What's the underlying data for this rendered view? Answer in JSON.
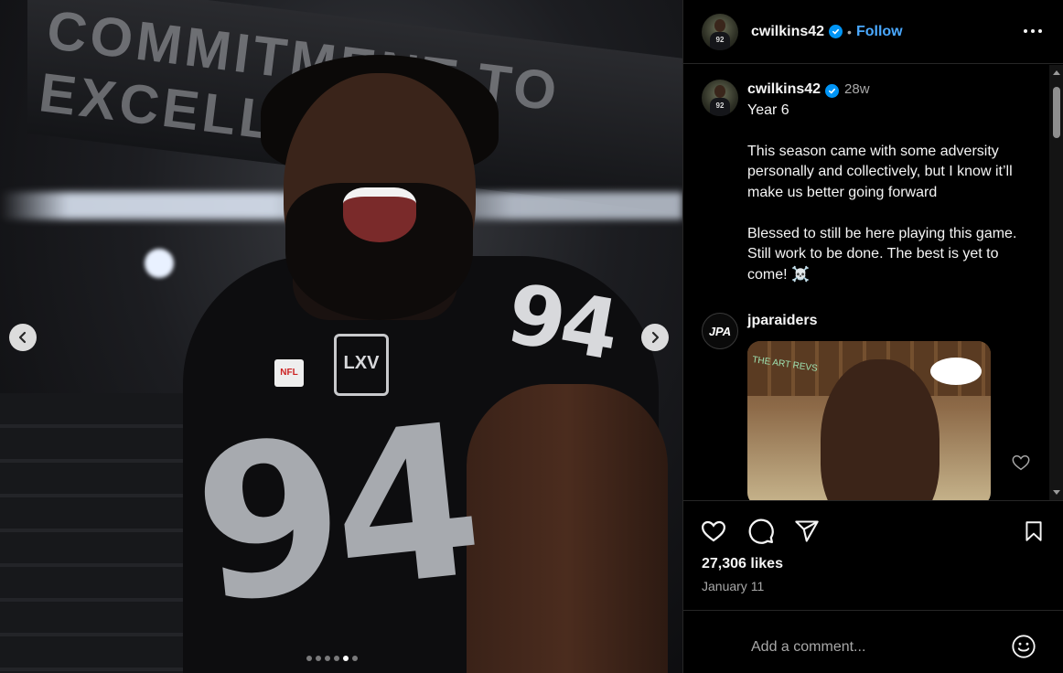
{
  "post": {
    "author": {
      "username": "cwilkins42",
      "verified": true,
      "follow_label": "Follow",
      "separator": "•",
      "avatar_jersey_number": "92"
    },
    "media": {
      "jersey_number": "94",
      "patch_text": "LXV",
      "shield_text": "NFL",
      "banner_text": "COMMITMENT TO EXCELLENCE",
      "carousel_total": 6,
      "carousel_active_index": 4
    },
    "caption": {
      "username": "cwilkins42",
      "age": "28w",
      "lines": [
        "Year 6",
        "This season came with some adversity personally and collectively, but I know it’ll make us better going forward",
        "Blessed to still be here playing this game. Still work to be done. The best is yet to come! ☠️"
      ]
    },
    "comments": [
      {
        "username": "jparaiders",
        "avatar_text": "JPA",
        "media_sign_text": "THE ART REVS"
      }
    ],
    "likes_text": "27,306 likes",
    "date_text": "January 11",
    "comment_input": {
      "placeholder": "Add a comment..."
    }
  },
  "colors": {
    "link": "#4aa9ff",
    "verified": "#0095f6",
    "muted": "#a8a8a8",
    "divider": "#262626"
  },
  "icons": [
    "chevron-left-icon",
    "chevron-right-icon",
    "more-icon",
    "verified-icon",
    "heart-icon",
    "comment-icon",
    "share-icon",
    "bookmark-icon",
    "emoji-icon"
  ]
}
